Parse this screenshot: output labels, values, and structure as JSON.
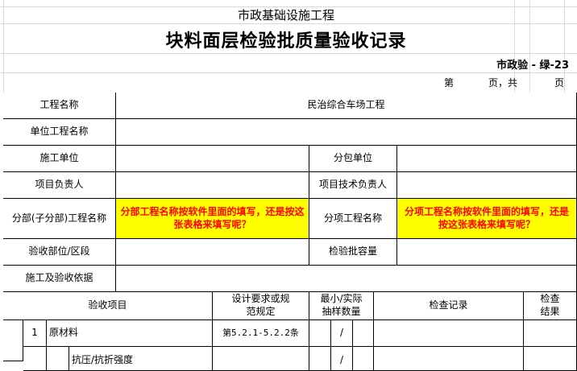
{
  "header": {
    "subtitle": "市政基础设施工程",
    "title": "块料面层检验批质量验收记录",
    "code": "市政验 - 绿-23",
    "page_di": "第",
    "page_ye_gong": "页，共",
    "page_ye": "页"
  },
  "form": {
    "project_name_label": "工程名称",
    "project_name_value": "民治综合车场工程",
    "unit_project_label": "单位工程名称",
    "construction_unit_label": "施工单位",
    "subcontractor_label": "分包单位",
    "project_manager_label": "项目负责人",
    "technical_manager_label": "项目技术负责人",
    "division_label": "分部(子分部)工程名称",
    "division_note": "分部工程名称按软件里面的填写，还是按这张表格来填写呢？",
    "subitem_label": "分项工程名称",
    "subitem_note": "分项工程名称按软件里面的填写，还是按这张表格来填写呢？",
    "location_label": "验收部位/区段",
    "batch_capacity_label": "检验批容量",
    "basis_label": "施工及验收依据"
  },
  "table": {
    "col_item": "验收项目",
    "col_design": "设计要求或规范规定",
    "col_sample": "最小/实际抽样数量",
    "col_record": "检查记录",
    "col_result": "检查结果",
    "rows": [
      {
        "no": "1",
        "item": "原材料",
        "spec": "第5.2.1-5.2.2条",
        "sample": "/"
      },
      {
        "no": "",
        "item": "抗压/抗折强度",
        "spec": "",
        "sample": "/"
      }
    ]
  }
}
